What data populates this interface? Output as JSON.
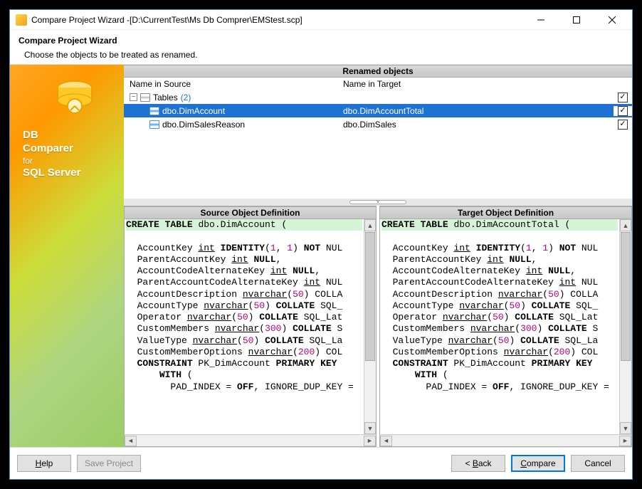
{
  "window": {
    "title": "Compare Project Wizard -[D:\\CurrentTest\\Ms Db Comprer\\EMStest.scp]"
  },
  "wizard": {
    "title": "Compare Project Wizard",
    "subtitle": "Choose the objects to be treated as renamed."
  },
  "brand": {
    "line1": "DB",
    "line2": "Comparer",
    "line3": "for",
    "line4": "SQL Server"
  },
  "renamed": {
    "header": "Renamed objects",
    "col_source": "Name in Source",
    "col_target": "Name in Target",
    "group_label": "Tables",
    "group_count": "(2)",
    "rows": [
      {
        "src": "dbo.DimAccount",
        "tgt": "dbo.DimAccountTotal",
        "checked": true,
        "selected": true
      },
      {
        "src": "dbo.DimSalesReason",
        "tgt": "dbo.DimSales",
        "checked": true,
        "selected": false
      }
    ]
  },
  "defs": {
    "source_header": "Source Object Definition",
    "target_header": "Target Object Definition",
    "source_code": "CREATE TABLE dbo.DimAccount (\n  AccountKey int IDENTITY(1, 1) NOT NUL\n  ParentAccountKey int NULL,\n  AccountCodeAlternateKey int NULL,\n  ParentAccountCodeAlternateKey int NUL\n  AccountDescription nvarchar(50) COLLA\n  AccountType nvarchar(50) COLLATE SQL_\n  Operator nvarchar(50) COLLATE SQL_Lat\n  CustomMembers nvarchar(300) COLLATE S\n  ValueType nvarchar(50) COLLATE SQL_La\n  CustomMemberOptions nvarchar(200) COL\n  CONSTRAINT PK_DimAccount PRIMARY KEY \n      WITH (\n        PAD_INDEX = OFF, IGNORE_DUP_KEY =",
    "target_code": "CREATE TABLE dbo.DimAccountTotal (\n  AccountKey int IDENTITY(1, 1) NOT NUL\n  ParentAccountKey int NULL,\n  AccountCodeAlternateKey int NULL,\n  ParentAccountCodeAlternateKey int NUL\n  AccountDescription nvarchar(50) COLLA\n  AccountType nvarchar(50) COLLATE SQL_\n  Operator nvarchar(50) COLLATE SQL_Lat\n  CustomMembers nvarchar(300) COLLATE S\n  ValueType nvarchar(50) COLLATE SQL_La\n  CustomMemberOptions nvarchar(200) COL\n  CONSTRAINT PK_DimAccount PRIMARY KEY \n      WITH (\n        PAD_INDEX = OFF, IGNORE_DUP_KEY ="
  },
  "footer": {
    "help": "Help",
    "save": "Save Project",
    "back": "< Back",
    "compare": "Compare",
    "cancel": "Cancel"
  }
}
